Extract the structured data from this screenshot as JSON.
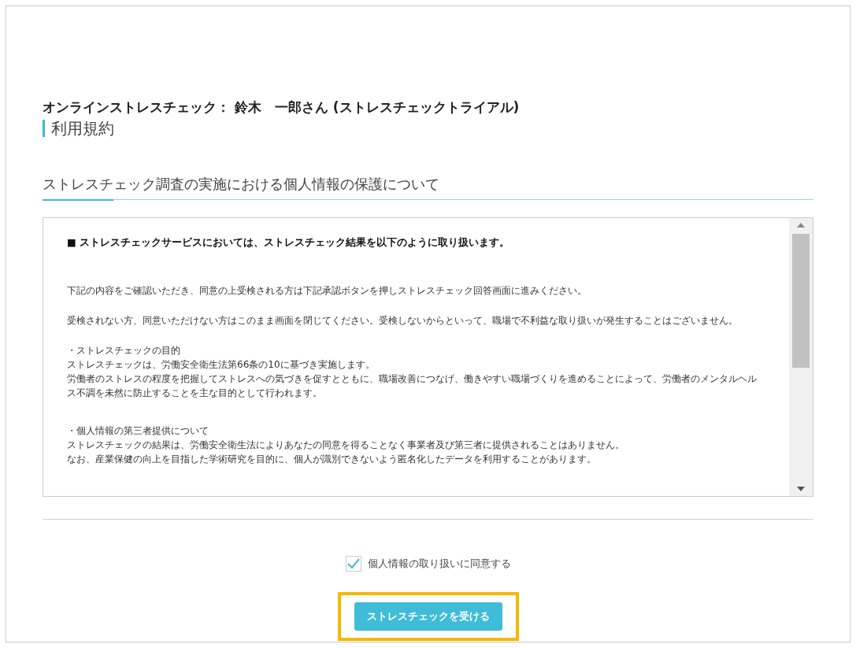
{
  "page_title": "オンラインストレスチェック： 鈴木　一郎さん (ストレスチェックトライアル)",
  "section_title": "利用規約",
  "subsection_title": "ストレスチェック調査の実施における個人情報の保護について",
  "terms": {
    "heading": "■ ストレスチェックサービスにおいては、ストレスチェック結果を以下のように取り扱います。",
    "blocks": [
      {
        "kind": "paragraph",
        "lines": [
          "下記の内容をご確認いただき、同意の上受検される方は下記承認ボタンを押しストレスチェック回答画面に進みください。"
        ]
      },
      {
        "kind": "paragraph",
        "lines": [
          "受検されない方、同意いただけない方はこのまま画面を閉じてください。受検しないからといって、職場で不利益な取り扱いが発生することはございません。"
        ]
      },
      {
        "kind": "section",
        "lines": [
          "・ストレスチェックの目的",
          "ストレスチェックは、労働安全衛生法第66条の10に基づき実施します。",
          "労働者のストレスの程度を把握してストレスへの気づきを促すとともに、職場改善につなげ、働きやすい職場づくりを進めることによって、労働者のメンタルヘルス不調を未然に防止することを主な目的として行われます。"
        ]
      },
      {
        "kind": "section",
        "lines": [
          "・個人情報の第三者提供について",
          "ストレスチェックの結果は、労働安全衛生法によりあなたの同意を得ることなく事業者及び第三者に提供されることはありません。",
          "なお、産業保健の向上を目指した学術研究を目的に、個人が識別できないよう匿名化したデータを利用することがあります。"
        ]
      }
    ]
  },
  "consent": {
    "label": "個人情報の取り扱いに同意する",
    "checked": true
  },
  "submit_button": {
    "label": "ストレスチェックを受ける",
    "highlighted": true
  }
}
